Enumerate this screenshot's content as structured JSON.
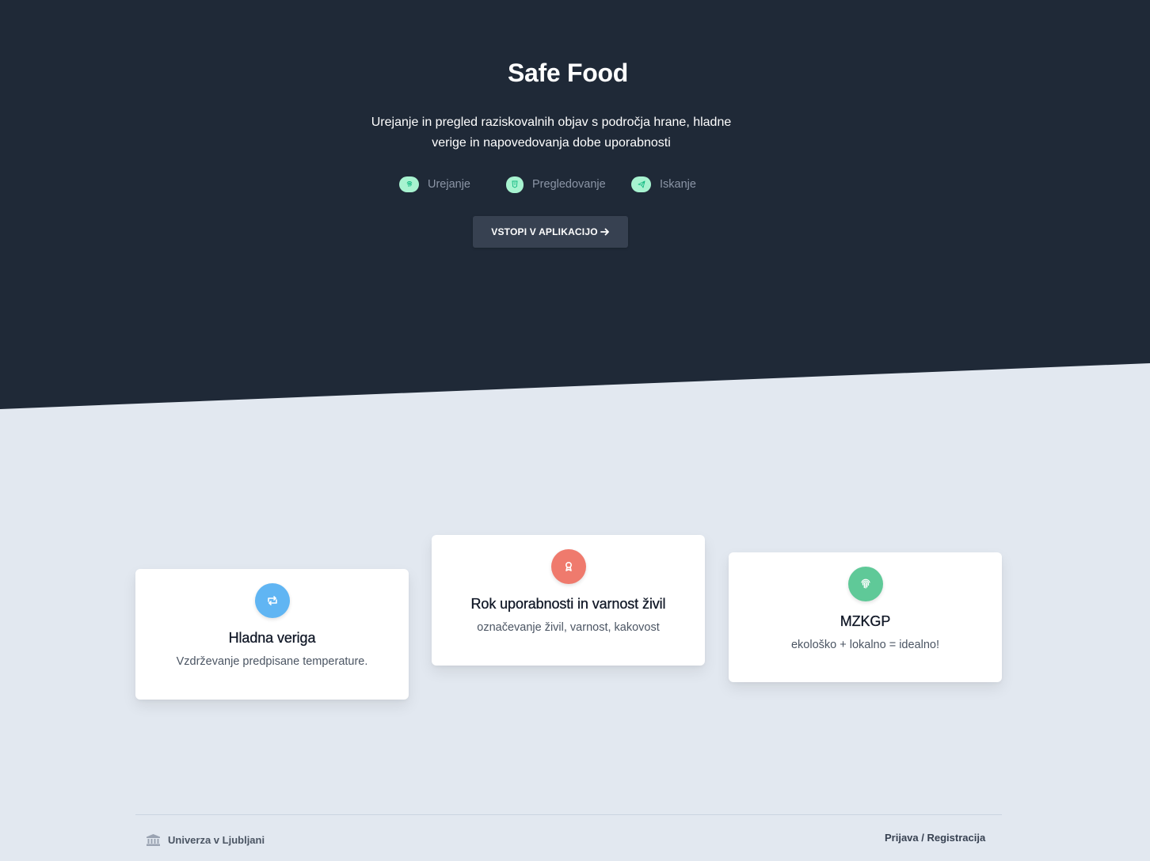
{
  "hero": {
    "title": "Safe Food",
    "subtitle": "Urejanje in pregled raziskovalnih objav s področja hrane, hladne verige in napovedovanja dobe uporabnosti",
    "features": [
      {
        "label": "Urejanje",
        "icon": "fingerprint-icon"
      },
      {
        "label": "Pregledovanje",
        "icon": "html5-icon"
      },
      {
        "label": "Iskanje",
        "icon": "paper-plane-icon"
      }
    ],
    "cta_label": "VSTOPI V APLIKACIJO",
    "cta_icon": "arrow-right-icon",
    "feature_icon_bg": "#a7f3d0",
    "feature_icon_color": "#10b981",
    "bg_color": "#1f2937"
  },
  "cards": [
    {
      "title": "Hladna veriga",
      "text": "Vzdrževanje predpisane temperature.",
      "icon": "retweet-icon",
      "color": "#60b5f3"
    },
    {
      "title": "Rok uporabnosti in varnost živil",
      "text": "označevanje živil, varnost, kakovost",
      "icon": "award-icon",
      "color": "#ef7a6d"
    },
    {
      "title": "MZKGP",
      "text": "ekološko + lokalno = idealno!",
      "icon": "fingerprint-icon",
      "color": "#5fc998"
    }
  ],
  "footer": {
    "org_label": "Univerza v Ljubljani",
    "org_icon": "university-icon",
    "login_label": "Prijava",
    "separator": " / ",
    "register_label": "Registracija"
  }
}
